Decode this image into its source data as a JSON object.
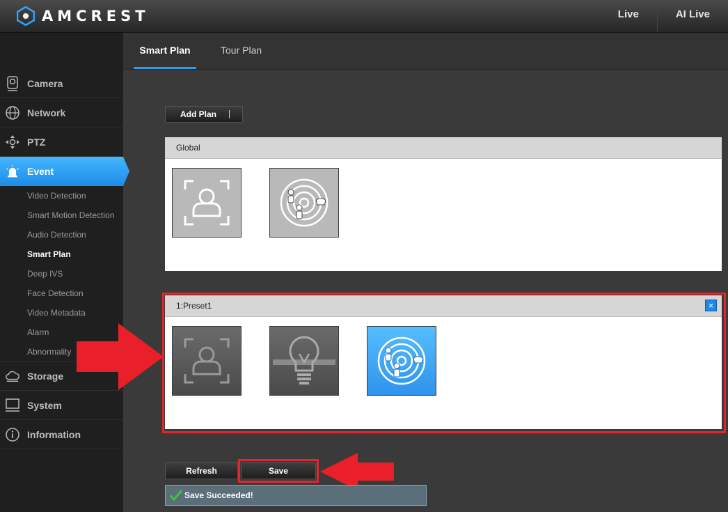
{
  "header": {
    "brand": "AMCREST",
    "nav": [
      "Live",
      "AI Live"
    ]
  },
  "sidebar": {
    "items": [
      {
        "label": "Camera",
        "icon": "camera-icon"
      },
      {
        "label": "Network",
        "icon": "network-globe-icon"
      },
      {
        "label": "PTZ",
        "icon": "ptz-directional-icon"
      },
      {
        "label": "Event",
        "icon": "alarm-light-icon",
        "active": true
      },
      {
        "label": "Storage",
        "icon": "cloud-storage-icon"
      },
      {
        "label": "System",
        "icon": "monitor-icon"
      },
      {
        "label": "Information",
        "icon": "info-icon"
      }
    ],
    "event_subitems": [
      "Video Detection",
      "Smart Motion Detection",
      "Audio Detection",
      "Smart Plan",
      "Deep IVS",
      "Face Detection",
      "Video Metadata",
      "Alarm",
      "Abnormality"
    ],
    "active_subitem": "Smart Plan"
  },
  "tabs": [
    "Smart Plan",
    "Tour Plan"
  ],
  "content": {
    "add_plan_label": "Add Plan",
    "global_title": "Global",
    "global_tiles": [
      "face-detection-icon",
      "ivs-radar-icon"
    ],
    "preset_title": "1:Preset1",
    "preset_close": "×",
    "preset_tiles": [
      {
        "icon": "face-detection-icon",
        "state": "off"
      },
      {
        "icon": "tripwire-bulb-icon",
        "state": "off"
      },
      {
        "icon": "ivs-radar-icon",
        "state": "selected"
      }
    ],
    "refresh_label": "Refresh",
    "save_label": "Save",
    "status_text": "Save Succeeded!"
  },
  "colors": {
    "accent": "#2b9cf0",
    "annotation": "#e0262e",
    "success": "#3cc23c"
  }
}
